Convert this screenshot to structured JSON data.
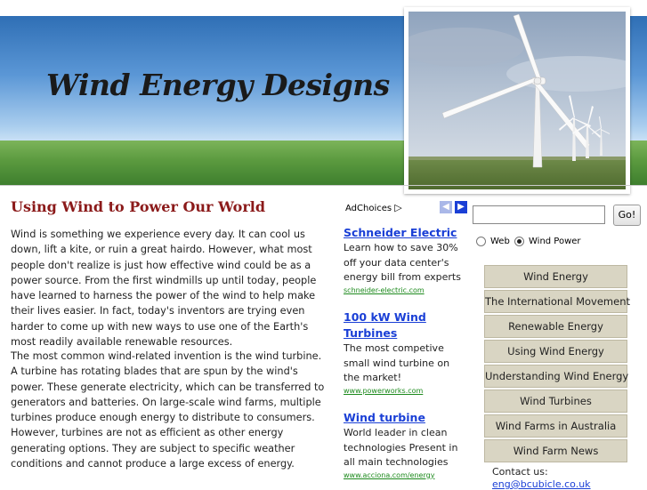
{
  "header": {
    "site_title": "Wind Energy Designs"
  },
  "main": {
    "title": "Using Wind to Power Our World",
    "paragraphs": [
      "Wind is something we experience every day. It can cool us down, lift a kite, or ruin a great hairdo. However, what most people don't realize is just how effective wind could be as a power source. From the first windmills up until today, people have learned to harness the power of the wind to help make their lives easier. In fact, today's inventors are trying even harder to come up with new ways to use one of the Earth's most readily available renewable resources.",
      "The most common wind-related invention is the wind turbine. A turbine has rotating blades that are spun by the wind's power. These generate electricity, which can be transferred to generators and batteries. On large-scale wind farms, multiple turbines produce enough energy to distribute to consumers. However, turbines are not as efficient as other energy generating options. They are subject to specific weather conditions and cannot produce a large excess of energy."
    ]
  },
  "ads": {
    "adchoices_label": "AdChoices",
    "prev_icon": "◀",
    "next_icon": "▶",
    "items": [
      {
        "title": "Schneider Electric",
        "text": "Learn how to save 30% off your data center's energy bill from experts",
        "url": "schneider-electric.com"
      },
      {
        "title": "100 kW Wind Turbines",
        "text": "The most competive small wind turbine on the market!",
        "url": "www.powerworks.com"
      },
      {
        "title": "Wind turbine",
        "text": "World leader in clean technologies Present in all main technologies",
        "url": "www.acciona.com/energy"
      }
    ]
  },
  "search": {
    "value": "",
    "button_label": "Go!",
    "options": [
      "Web",
      "Wind Power"
    ],
    "selected": "Wind Power"
  },
  "nav": {
    "items": [
      "Wind Energy",
      "The International Movement",
      "Renewable Energy",
      "Using Wind Energy",
      "Understanding Wind Energy",
      "Wind Turbines",
      "Wind Farms in Australia",
      "Wind Farm News"
    ]
  },
  "contact": {
    "label": "Contact us:",
    "email": "eng@bcubicle.co.uk"
  },
  "colors": {
    "title_red": "#8b1a1a",
    "link_blue": "#1a3fd6",
    "url_green": "#1d8a1d",
    "nav_bg": "#d9d5c3"
  },
  "icons": {
    "adchoices": "adchoices-triangle-icon",
    "photo": "wind-turbines-photo"
  }
}
